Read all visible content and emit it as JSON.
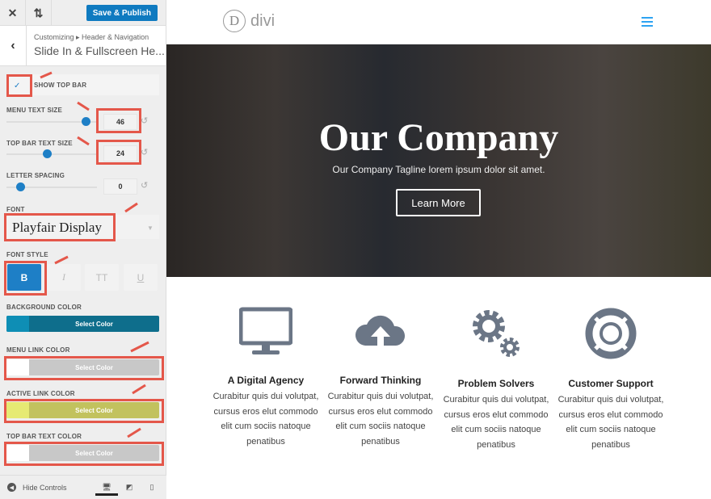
{
  "sidebar": {
    "save_label": "Save & Publish",
    "breadcrumb": "Customizing ▸ Header & Navigation",
    "section_title": "Slide In & Fullscreen He...",
    "show_top_bar": {
      "label": "SHOW TOP BAR",
      "checked": true
    },
    "menu_text_size": {
      "label": "MENU TEXT SIZE",
      "value": "46"
    },
    "top_bar_text_size": {
      "label": "TOP BAR TEXT SIZE",
      "value": "24"
    },
    "letter_spacing": {
      "label": "LETTER SPACING",
      "value": "0"
    },
    "font": {
      "label": "FONT",
      "value": "Playfair Display"
    },
    "font_style": {
      "label": "FONT STYLE",
      "bold": "B",
      "italic": "I",
      "uppercase": "TT",
      "underline": "U",
      "active": "bold"
    },
    "background_color": {
      "label": "BACKGROUND COLOR",
      "button": "Select Color",
      "color": "#0e6e8c"
    },
    "menu_link_color": {
      "label": "MENU LINK COLOR",
      "button": "Select Color",
      "color": "#ffffff"
    },
    "active_link_color": {
      "label": "ACTIVE LINK COLOR",
      "button": "Select Color",
      "color": "#e6ea73"
    },
    "top_bar_text_color": {
      "label": "TOP BAR TEXT COLOR",
      "button": "Select Color",
      "color": "#ffffff"
    },
    "hide_controls": "Hide Controls"
  },
  "preview": {
    "logo": "divi",
    "hero": {
      "title": "Our Company",
      "tagline": "Our Company Tagline lorem ipsum dolor sit amet.",
      "button": "Learn More"
    },
    "features": [
      {
        "icon": "monitor-icon",
        "title": "A Digital Agency",
        "text": "Curabitur quis dui volutpat, cursus eros elut commodo elit cum sociis natoque penatibus"
      },
      {
        "icon": "cloud-upload-icon",
        "title": "Forward Thinking",
        "text": "Curabitur quis dui volutpat, cursus eros elut commodo elit cum sociis natoque penatibus"
      },
      {
        "icon": "gears-icon",
        "title": "Problem Solvers",
        "text": "Curabitur quis dui volutpat, cursus eros elut commodo elit cum sociis natoque penatibus"
      },
      {
        "icon": "life-ring-icon",
        "title": "Customer Support",
        "text": "Curabitur quis dui volutpat, cursus eros elut commodo elit cum sociis natoque penatibus"
      }
    ]
  }
}
